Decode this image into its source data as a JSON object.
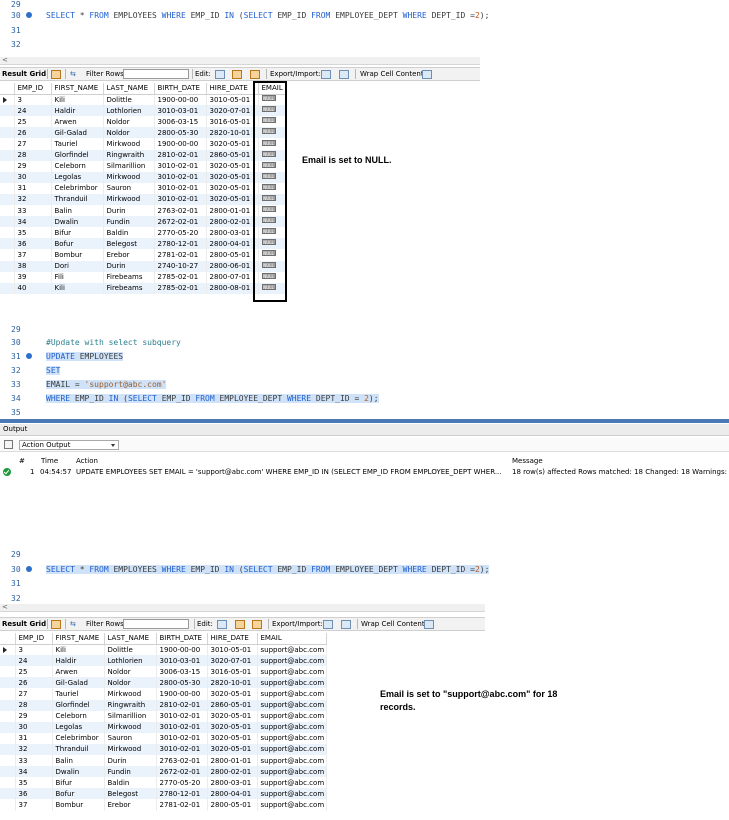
{
  "query1": {
    "lines": [
      {
        "num": "29"
      },
      {
        "num": "30",
        "select": "SELECT",
        "star": "*",
        "from": "FROM",
        "table": "EMPLOYEES",
        "where": "WHERE",
        "col": "EMP_ID",
        "in": "IN",
        "open": "(",
        "select2": "SELECT",
        "col2": "EMP_ID",
        "from2": "FROM",
        "table2": "EMPLOYEE_DEPT",
        "where2": "WHERE",
        "col3": "DEPT_ID",
        "eq": "=",
        "value": "2",
        "close": ");"
      },
      {
        "num": "31"
      },
      {
        "num": "32"
      }
    ]
  },
  "toolbar": {
    "result_grid": "Result Grid",
    "filter_rows": "Filter Rows:",
    "edit": "Edit:",
    "export_import": "Export/Import:",
    "wrap_cell": "Wrap Cell Content:"
  },
  "grid1": {
    "columns": [
      "EMP_ID",
      "FIRST_NAME",
      "LAST_NAME",
      "BIRTH_DATE",
      "HIRE_DATE",
      "EMAIL"
    ],
    "null_label": "NULL",
    "rows": [
      [
        "3",
        "Kili",
        "Dolittle",
        "1900-00-00",
        "3010-05-01"
      ],
      [
        "24",
        "Haldir",
        "Lothlorien",
        "3010-03-01",
        "3020-07-01"
      ],
      [
        "25",
        "Arwen",
        "Noldor",
        "3006-03-15",
        "3016-05-01"
      ],
      [
        "26",
        "Gil-Galad",
        "Noldor",
        "2800-05-30",
        "2820-10-01"
      ],
      [
        "27",
        "Tauriel",
        "Mirkwood",
        "1900-00-00",
        "3020-05-01"
      ],
      [
        "28",
        "Glorfindel",
        "Ringwraith",
        "2810-02-01",
        "2860-05-01"
      ],
      [
        "29",
        "Celeborn",
        "Silmarillion",
        "3010-02-01",
        "3020-05-01"
      ],
      [
        "30",
        "Legolas",
        "Mirkwood",
        "3010-02-01",
        "3020-05-01"
      ],
      [
        "31",
        "Celebrimbor",
        "Sauron",
        "3010-02-01",
        "3020-05-01"
      ],
      [
        "32",
        "Thranduil",
        "Mirkwood",
        "3010-02-01",
        "3020-05-01"
      ],
      [
        "33",
        "Balin",
        "Durin",
        "2763-02-01",
        "2800-01-01"
      ],
      [
        "34",
        "Dwalin",
        "Fundin",
        "2672-02-01",
        "2800-02-01"
      ],
      [
        "35",
        "Bifur",
        "Baldin",
        "2770-05-20",
        "2800-03-01"
      ],
      [
        "36",
        "Bofur",
        "Belegost",
        "2780-12-01",
        "2800-04-01"
      ],
      [
        "37",
        "Bombur",
        "Erebor",
        "2781-02-01",
        "2800-05-01"
      ],
      [
        "38",
        "Dori",
        "Durin",
        "2740-10-27",
        "2800-06-01"
      ],
      [
        "39",
        "Fili",
        "Firebeams",
        "2785-02-01",
        "2800-07-01"
      ],
      [
        "40",
        "Kili",
        "Firebeams",
        "2785-02-01",
        "2800-08-01"
      ]
    ]
  },
  "annotation1": "Email is set to NULL.",
  "update": {
    "lines": [
      {
        "num": "29"
      },
      {
        "num": "30",
        "comment": "#Update with select subquery"
      },
      {
        "num": "31",
        "kw1": "UPDATE",
        "table": "EMPLOYEES"
      },
      {
        "num": "32",
        "kw": "SET"
      },
      {
        "num": "33",
        "lhs": "EMAIL =",
        "str": "'support@abc.com'"
      },
      {
        "num": "34",
        "where": "WHERE",
        "col": "EMP_ID",
        "in": "IN",
        "open": "(",
        "select": "SELECT",
        "col2": "EMP_ID",
        "from": "FROM",
        "table2": "EMPLOYEE_DEPT",
        "where2": "WHERE",
        "col3": "DEPT_ID",
        "eq": "=",
        "value": "2",
        "close": ");"
      },
      {
        "num": "35"
      }
    ]
  },
  "output": {
    "title": "Output",
    "dropdown": "Action Output",
    "columns": {
      "hash": "#",
      "time": "Time",
      "action": "Action",
      "message": "Message"
    },
    "row": {
      "index": "1",
      "time": "04:54:57",
      "action": "UPDATE EMPLOYEES SET  EMAIL = 'support@abc.com' WHERE EMP_ID IN (SELECT EMP_ID FROM EMPLOYEE_DEPT WHER...",
      "message": "18 row(s) affected Rows matched: 18  Changed: 18  Warnings: 0"
    }
  },
  "query2": {
    "lines": [
      {
        "num": "29"
      },
      {
        "num": "30",
        "select": "SELECT",
        "star": "*",
        "from": "FROM",
        "table": "EMPLOYEES",
        "where": "WHERE",
        "col": "EMP_ID",
        "in": "IN",
        "open": "(",
        "select2": "SELECT",
        "col2": "EMP_ID",
        "from2": "FROM",
        "table2": "EMPLOYEE_DEPT",
        "where2": "WHERE",
        "col3": "DEPT_ID",
        "eq": "=",
        "value": "2",
        "close": ");"
      },
      {
        "num": "31"
      },
      {
        "num": "32"
      }
    ]
  },
  "grid2": {
    "columns": [
      "EMP_ID",
      "FIRST_NAME",
      "LAST_NAME",
      "BIRTH_DATE",
      "HIRE_DATE",
      "EMAIL"
    ],
    "rows": [
      [
        "3",
        "Kili",
        "Dolittle",
        "1900-00-00",
        "3010-05-01",
        "support@abc.com"
      ],
      [
        "24",
        "Haldir",
        "Lothlorien",
        "3010-03-01",
        "3020-07-01",
        "support@abc.com"
      ],
      [
        "25",
        "Arwen",
        "Noldor",
        "3006-03-15",
        "3016-05-01",
        "support@abc.com"
      ],
      [
        "26",
        "Gil-Galad",
        "Noldor",
        "2800-05-30",
        "2820-10-01",
        "support@abc.com"
      ],
      [
        "27",
        "Tauriel",
        "Mirkwood",
        "1900-00-00",
        "3020-05-01",
        "support@abc.com"
      ],
      [
        "28",
        "Glorfindel",
        "Ringwraith",
        "2810-02-01",
        "2860-05-01",
        "support@abc.com"
      ],
      [
        "29",
        "Celeborn",
        "Silmarillion",
        "3010-02-01",
        "3020-05-01",
        "support@abc.com"
      ],
      [
        "30",
        "Legolas",
        "Mirkwood",
        "3010-02-01",
        "3020-05-01",
        "support@abc.com"
      ],
      [
        "31",
        "Celebrimbor",
        "Sauron",
        "3010-02-01",
        "3020-05-01",
        "support@abc.com"
      ],
      [
        "32",
        "Thranduil",
        "Mirkwood",
        "3010-02-01",
        "3020-05-01",
        "support@abc.com"
      ],
      [
        "33",
        "Balin",
        "Durin",
        "2763-02-01",
        "2800-01-01",
        "support@abc.com"
      ],
      [
        "34",
        "Dwalin",
        "Fundin",
        "2672-02-01",
        "2800-02-01",
        "support@abc.com"
      ],
      [
        "35",
        "Bifur",
        "Baldin",
        "2770-05-20",
        "2800-03-01",
        "support@abc.com"
      ],
      [
        "36",
        "Bofur",
        "Belegost",
        "2780-12-01",
        "2800-04-01",
        "support@abc.com"
      ],
      [
        "37",
        "Bombur",
        "Erebor",
        "2781-02-01",
        "2800-05-01",
        "support@abc.com"
      ]
    ]
  },
  "annotation2": "Email is set to \"support@abc.com\" for 18 records.",
  "colors": {
    "keyword": "#1f5fd0",
    "selection": "#cfe2f7",
    "alt_row": "#eaf2fb",
    "ok": "#1e9a3b"
  }
}
